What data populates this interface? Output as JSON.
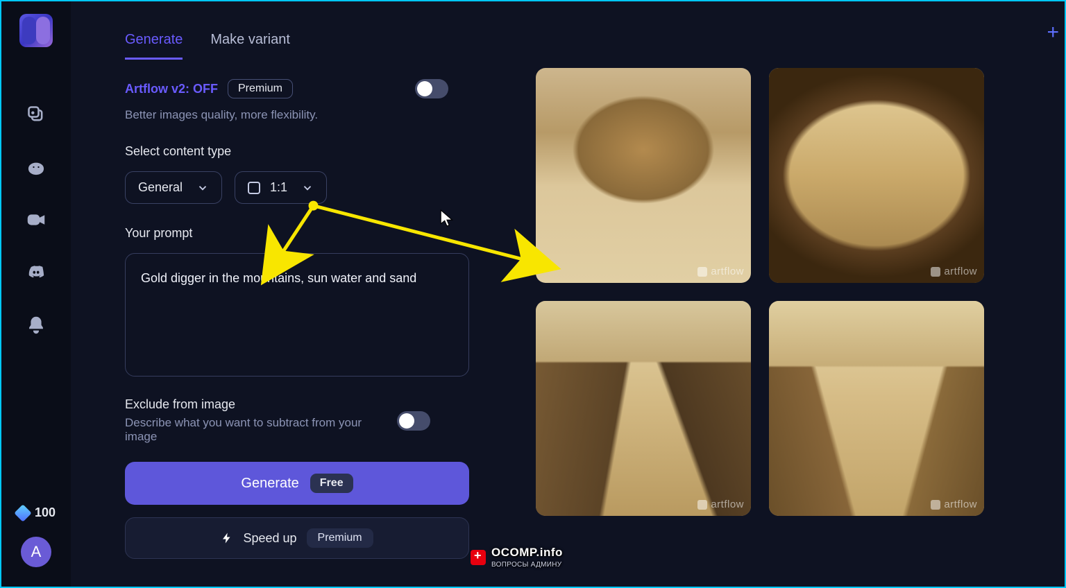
{
  "sidebar": {
    "credits": "100",
    "avatar_initial": "A"
  },
  "tabs": {
    "generate": "Generate",
    "variant": "Make variant"
  },
  "v2": {
    "label": "Artflow v2: OFF",
    "badge": "Premium",
    "desc": "Better images quality, more flexibility."
  },
  "content_type": {
    "label": "Select content type",
    "general": "General",
    "ratio": "1:1"
  },
  "prompt": {
    "label": "Your prompt",
    "text": "Gold digger in the mountains, sun water and sand"
  },
  "exclude": {
    "label": "Exclude from image",
    "desc": "Describe what you want to subtract from your image"
  },
  "buttons": {
    "generate": "Generate",
    "generate_tag": "Free",
    "speedup": "Speed up",
    "speedup_tag": "Premium"
  },
  "watermark": "artflow",
  "annotation": {
    "site": "OCOMP.info",
    "sub": "ВОПРОСЫ АДМИНУ"
  }
}
